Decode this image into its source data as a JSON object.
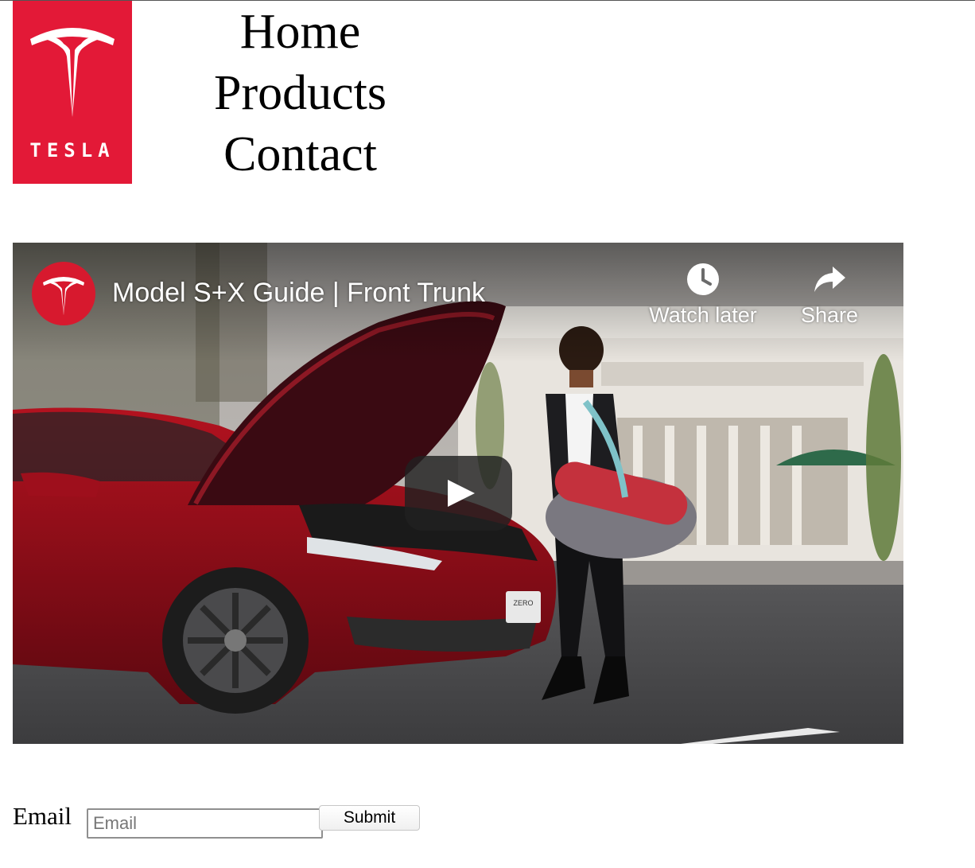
{
  "brand": {
    "logo_text": "TESLA",
    "logo_color": "#e31937"
  },
  "nav": {
    "items": [
      {
        "label": "Home"
      },
      {
        "label": "Products"
      },
      {
        "label": "Contact"
      }
    ]
  },
  "video": {
    "title": "Model S+X Guide | Front Trunk",
    "channel_icon": "tesla-channel-avatar",
    "actions": [
      {
        "label": "Watch later",
        "icon": "clock-icon"
      },
      {
        "label": "Share",
        "icon": "share-arrow-icon"
      }
    ],
    "play_icon": "play-icon",
    "license_plate_text": "ZERO EMISSIONS"
  },
  "form": {
    "email_label": "Email",
    "email_placeholder": "Email",
    "email_value": "",
    "submit_label": "Submit"
  }
}
